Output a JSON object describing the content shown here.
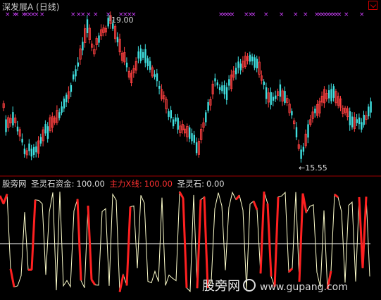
{
  "header": {
    "title": "深发展A (日线)"
  },
  "price_chart": {
    "high_label": "19.00",
    "low_label": "←15.55",
    "colors": {
      "up": "#ff4040",
      "down": "#40e0e0",
      "marker": "#d040ff"
    }
  },
  "indicator": {
    "name": "股旁网",
    "field1_label": "圣灵石资金:",
    "field1_value": "100.00",
    "field2_label": "主力X线:",
    "field2_value": "100.00",
    "field3_label": "圣灵石:",
    "field3_value": "0.00",
    "colors": {
      "main": "#ffffcc",
      "alt": "#ff2020",
      "mid": "#ffffff"
    }
  },
  "watermark": {
    "text": "股旁网",
    "url": "www.gupang.com"
  }
}
